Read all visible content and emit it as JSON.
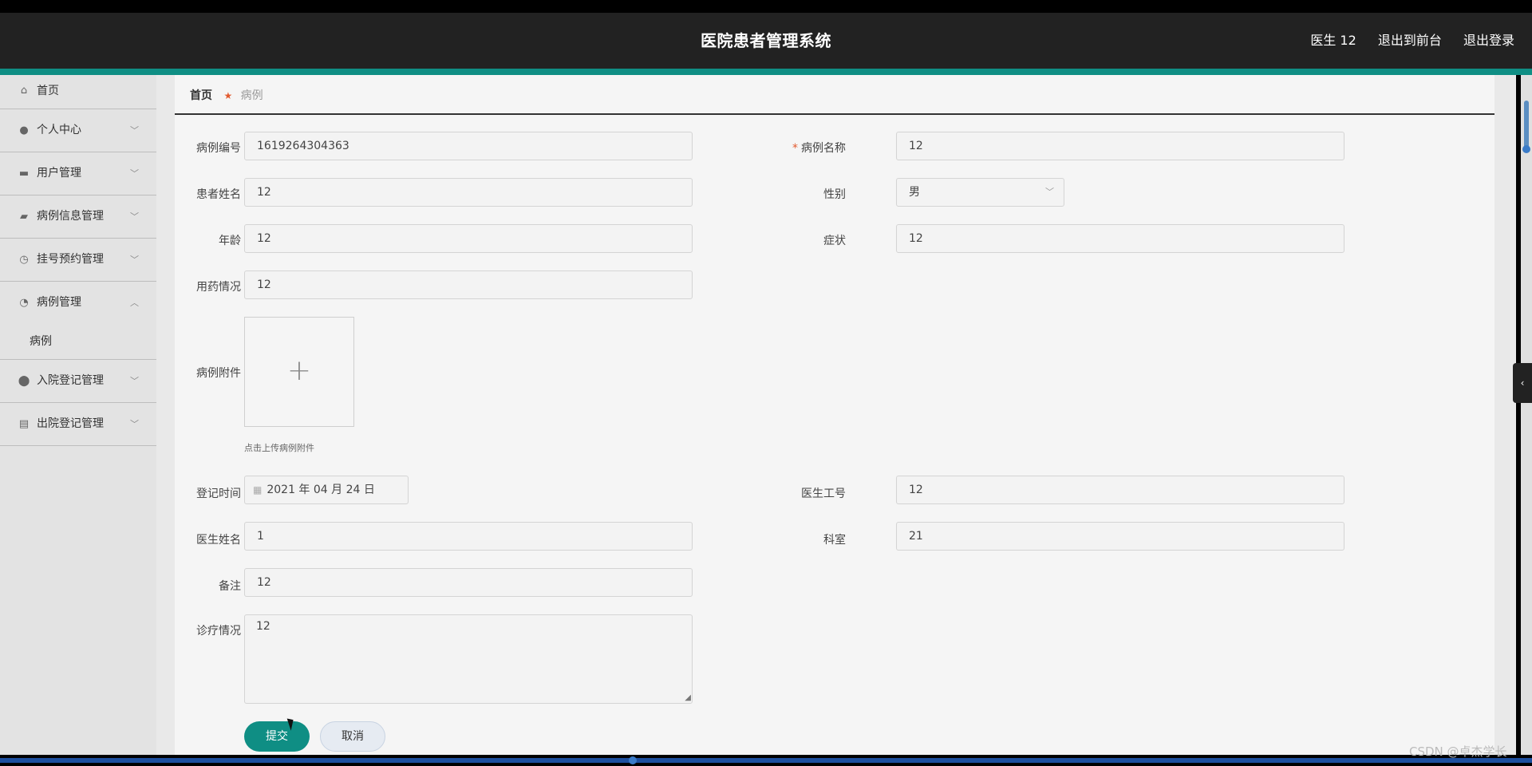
{
  "header": {
    "title": "医院患者管理系统",
    "user": "医生 12",
    "front_link": "退出到前台",
    "logout_link": "退出登录"
  },
  "sidebar": {
    "items": [
      {
        "label": "首页",
        "icon": "home-icon"
      },
      {
        "label": "个人中心",
        "icon": "user-icon"
      },
      {
        "label": "用户管理",
        "icon": "monitor-icon"
      },
      {
        "label": "病例信息管理",
        "icon": "briefcase-icon"
      },
      {
        "label": "挂号预约管理",
        "icon": "clock-icon"
      },
      {
        "label": "病例管理",
        "icon": "gauge-icon"
      },
      {
        "label": "入院登记管理",
        "icon": "location-icon"
      },
      {
        "label": "出院登记管理",
        "icon": "clipboard-icon"
      }
    ],
    "submenu": {
      "label": "病例"
    }
  },
  "breadcrumb": {
    "home": "首页",
    "current": "病例"
  },
  "form": {
    "case_no": {
      "label": "病例编号",
      "value": "1619264304363"
    },
    "case_name": {
      "label": "病例名称",
      "value": "12",
      "required_mark": "*"
    },
    "patient_name": {
      "label": "患者姓名",
      "value": "12"
    },
    "gender": {
      "label": "性别",
      "value": "男"
    },
    "age": {
      "label": "年龄",
      "value": "12"
    },
    "symptom": {
      "label": "症状",
      "value": "12"
    },
    "medication": {
      "label": "用药情况",
      "value": "12"
    },
    "attachment": {
      "label": "病例附件",
      "hint": "点击上传病例附件"
    },
    "reg_time": {
      "label": "登记时间",
      "value": "2021 年 04 月 24 日"
    },
    "doctor_id": {
      "label": "医生工号",
      "value": "12"
    },
    "doctor_name": {
      "label": "医生姓名",
      "value": "1"
    },
    "department": {
      "label": "科室",
      "value": "21"
    },
    "remark": {
      "label": "备注",
      "value": "12"
    },
    "diagnosis": {
      "label": "诊疗情况",
      "value": "12"
    }
  },
  "buttons": {
    "submit": "提交",
    "cancel": "取消"
  },
  "watermark": "CSDN @卓杰学长",
  "colors": {
    "accent": "#0f8e84",
    "header_bg": "#222222",
    "required": "#e25a2f"
  }
}
